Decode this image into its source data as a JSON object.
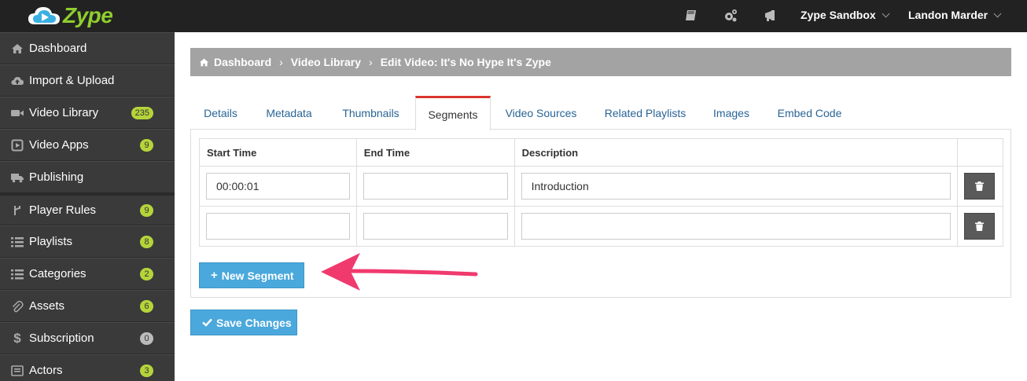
{
  "topbar": {
    "logo_text": "Zype",
    "account_menu": "Zype Sandbox",
    "user_menu": "Landon Marder",
    "icons": [
      "book-icon",
      "gears-icon",
      "bullhorn-icon"
    ]
  },
  "sidebar": {
    "items": [
      {
        "label": "Dashboard",
        "icon": "home-icon",
        "badge": null
      },
      {
        "label": "Import & Upload",
        "icon": "cloud-upload-icon",
        "badge": null
      },
      {
        "label": "Video Library",
        "icon": "video-camera-icon",
        "badge": "235"
      },
      {
        "label": "Video Apps",
        "icon": "play-square-icon",
        "badge": "9"
      },
      {
        "label": "Publishing",
        "icon": "truck-icon",
        "badge": null
      },
      {
        "label": "Player Rules",
        "icon": "code-fork-icon",
        "badge": "9"
      },
      {
        "label": "Playlists",
        "icon": "list-icon",
        "badge": "8"
      },
      {
        "label": "Categories",
        "icon": "list-icon",
        "badge": "2"
      },
      {
        "label": "Assets",
        "icon": "paperclip-icon",
        "badge": "6"
      },
      {
        "label": "Subscription",
        "icon": "dollar-icon",
        "badge": "0"
      },
      {
        "label": "Actors",
        "icon": "list-alt-icon",
        "badge": "3"
      }
    ]
  },
  "breadcrumb": {
    "items": [
      "Dashboard",
      "Video Library",
      "Edit Video: It's No Hype It's Zype"
    ]
  },
  "tabs": [
    "Details",
    "Metadata",
    "Thumbnails",
    "Segments",
    "Video Sources",
    "Related Playlists",
    "Images",
    "Embed Code"
  ],
  "active_tab": "Segments",
  "segments_table": {
    "headers": [
      "Start Time",
      "End Time",
      "Description",
      ""
    ],
    "rows": [
      {
        "start": "00:00:01",
        "end": "",
        "description": "Introduction"
      },
      {
        "start": "",
        "end": "",
        "description": ""
      }
    ]
  },
  "buttons": {
    "new_segment": "New Segment",
    "save_changes": "Save Changes"
  },
  "colors": {
    "topbar": "#222222",
    "sidebar": "#3a3a3a",
    "logo_green": "#8fce2e",
    "badge_green": "#b6d43a",
    "button_blue": "#4aa8dc",
    "active_tab_accent": "#d9352d",
    "annotation_arrow": "#f03a6e"
  }
}
